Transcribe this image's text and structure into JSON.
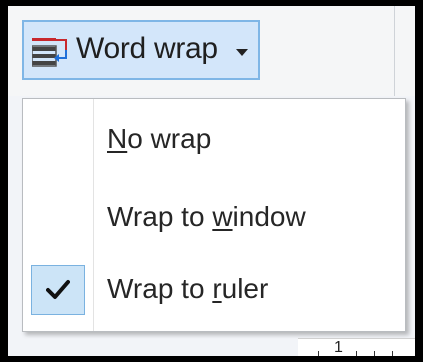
{
  "toolbar": {
    "word_wrap_label": "Word wrap",
    "word_wrap_icon": "word-wrap-icon",
    "dropdown_icon": "caret-down-icon"
  },
  "menu": {
    "items": [
      {
        "before": "",
        "mnemonic": "N",
        "after": "o wrap",
        "checked": false
      },
      {
        "before": "Wrap to ",
        "mnemonic": "w",
        "after": "indow",
        "checked": false
      },
      {
        "before": "Wrap to ",
        "mnemonic": "r",
        "after": "uler",
        "checked": true
      }
    ],
    "check_icon": "checkmark-icon"
  },
  "ruler": {
    "label": "1"
  },
  "colors": {
    "button_bg": "#d3e6fa",
    "button_border": "#7fb6e6",
    "check_bg": "#cce4f7",
    "icon_red": "#c8282d",
    "icon_blue": "#1e6fd9"
  }
}
